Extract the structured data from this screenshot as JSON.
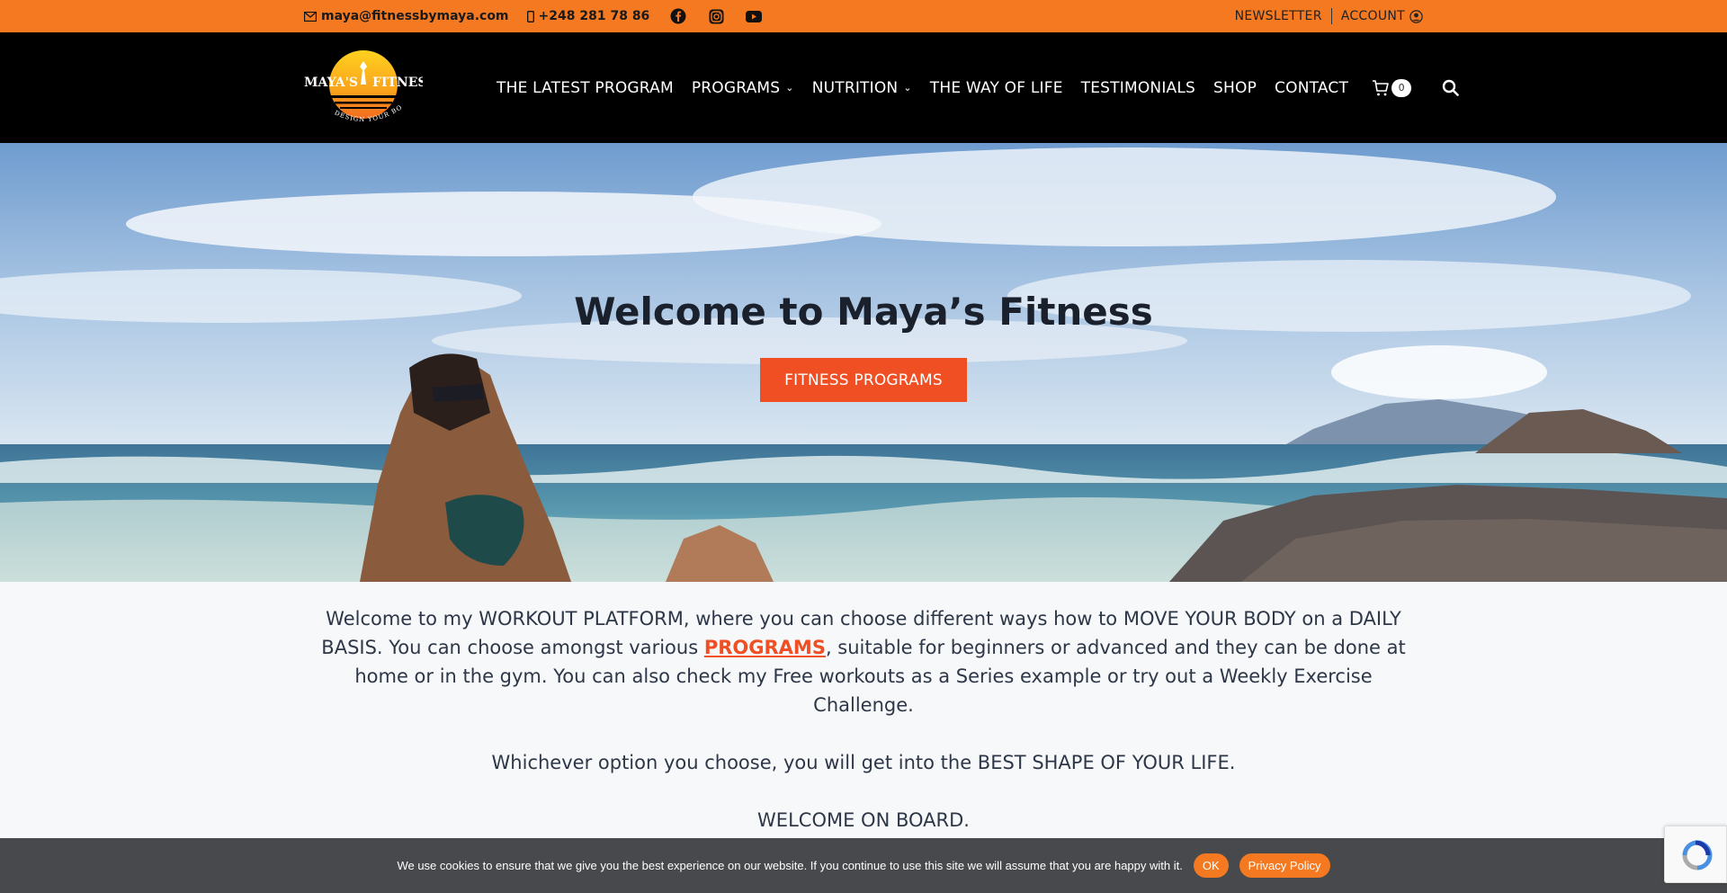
{
  "topbar": {
    "email": "maya@fitnessbymaya.com",
    "phone": "+248 281 78 86",
    "newsletter": "NEWSLETTER",
    "account": "ACCOUNT"
  },
  "logo": {
    "brand": "MAYA'S FITNESS",
    "tagline": "DESIGN YOUR BODY"
  },
  "nav": {
    "items": [
      {
        "label": "THE LATEST PROGRAM"
      },
      {
        "label": "PROGRAMS"
      },
      {
        "label": "NUTRITION"
      },
      {
        "label": "THE WAY OF LIFE"
      },
      {
        "label": "TESTIMONIALS"
      },
      {
        "label": "SHOP"
      },
      {
        "label": "CONTACT"
      }
    ],
    "cart_count": "0"
  },
  "hero": {
    "title": "Welcome to Maya’s Fitness",
    "cta": "FITNESS PROGRAMS"
  },
  "intro": {
    "p1_before": "Welcome to my WORKOUT PLATFORM, where you can choose different ways how to MOVE YOUR BODY on a DAILY BASIS. You can choose amongst various ",
    "p1_link": "PROGRAMS",
    "p1_after": ", suitable for beginners or advanced and they can be done at home or in the gym. You can also check my Free workouts as a Series example or try out a Weekly Exercise Challenge.",
    "p2": "Whichever option you choose, you will get into the BEST SHAPE OF YOUR LIFE.",
    "p3": "WELCOME ON BOARD."
  },
  "cookie": {
    "message": "We use cookies to ensure that we give you the best experience on our website. If you continue to use this site we will assume that you are happy with it.",
    "ok": "OK",
    "privacy": "Privacy Policy",
    "close": "✕"
  },
  "colors": {
    "topbar": "#f47920",
    "header": "#000000",
    "accent": "#f04e23"
  }
}
